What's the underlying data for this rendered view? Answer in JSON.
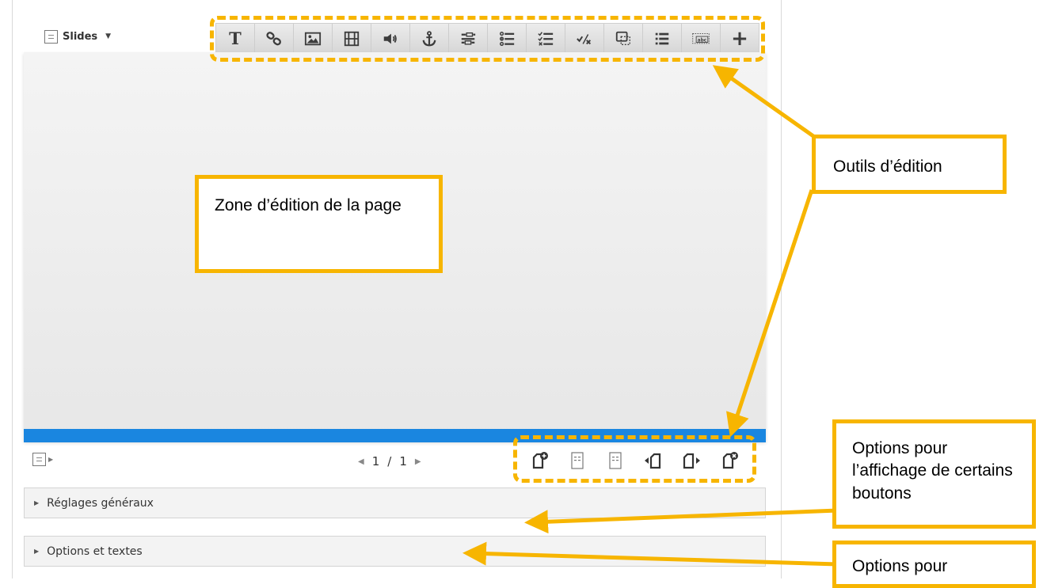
{
  "header": {
    "title": "Slides",
    "caret_icon": "caret-down-icon"
  },
  "toolbar": {
    "buttons": [
      {
        "name": "text-icon",
        "label": "T"
      },
      {
        "name": "link-icon"
      },
      {
        "name": "image-icon"
      },
      {
        "name": "video-icon"
      },
      {
        "name": "audio-icon"
      },
      {
        "name": "anchor-icon"
      },
      {
        "name": "fill-in-blanks-icon"
      },
      {
        "name": "single-choice-icon"
      },
      {
        "name": "multiple-choice-icon"
      },
      {
        "name": "true-false-icon"
      },
      {
        "name": "drag-question-icon"
      },
      {
        "name": "summary-icon"
      },
      {
        "name": "drag-text-icon",
        "label": "abc"
      },
      {
        "name": "plus-icon",
        "label": "+"
      }
    ]
  },
  "pager": {
    "current": "1",
    "separator": "/",
    "total": "1"
  },
  "sections": [
    {
      "label": "Réglages généraux"
    },
    {
      "label": "Options et textes"
    }
  ],
  "callouts": {
    "zone": "Zone d’édition de la page",
    "outils": "Outils d’édition",
    "options_affichage": "Options pour l’affichage de certains boutons",
    "options_pour": "Options pour"
  },
  "colors": {
    "accent_yellow": "#f7b500",
    "progress_blue": "#1a86e0"
  }
}
